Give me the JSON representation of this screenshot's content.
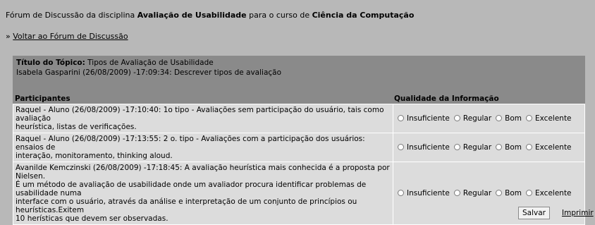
{
  "header": {
    "prefix": "Fórum de Discussão da disciplina ",
    "discipline": "Avaliação de Usabilidade",
    "middle": " para o curso de ",
    "course": "Ciência da Computação"
  },
  "back": {
    "marker": "» ",
    "link": "Voltar ao Fórum de Discussão"
  },
  "topic": {
    "title_label": "Título do Tópico:",
    "title_value": " Tipos de Avaliação de Usabilidade",
    "author_line": "Isabela Gasparini (26/08/2009) -17:09:34:  Descrever tipos de avaliação"
  },
  "columns": {
    "participants": "Participantes",
    "quality": "Qualidade da Informação"
  },
  "options": [
    "Insuficiente",
    "Regular",
    "Bom",
    "Excelente"
  ],
  "posts": [
    {
      "lines": [
        " Raquel - Aluno (26/08/2009) -17:10:40:  1o tipo - Avaliações sem participação do usuário, tais como avaliação",
        "heurística, listas de verificações."
      ]
    },
    {
      "lines": [
        " Raquel - Aluno (26/08/2009) -17:13:55:  2 o. tipo - Avaliações com a participação dos usuários: ensaios de",
        "interação, monitoramento, thinking aloud."
      ]
    },
    {
      "lines": [
        " Avanilde Kemczinski (26/08/2009) -17:18:45:  A avaliação heurística mais conhecida é a proposta por Nielsen.",
        "É um método de avaliação de usabilidade onde um avaliador procura identificar problemas de usabilidade numa",
        "interface com o usuário, através da análise e interpretação de um conjunto de princípios ou heurísticas.Exitem",
        "10 herísticas que devem ser observadas."
      ]
    }
  ],
  "actions": {
    "save": "Salvar",
    "print": "Imprimir"
  }
}
